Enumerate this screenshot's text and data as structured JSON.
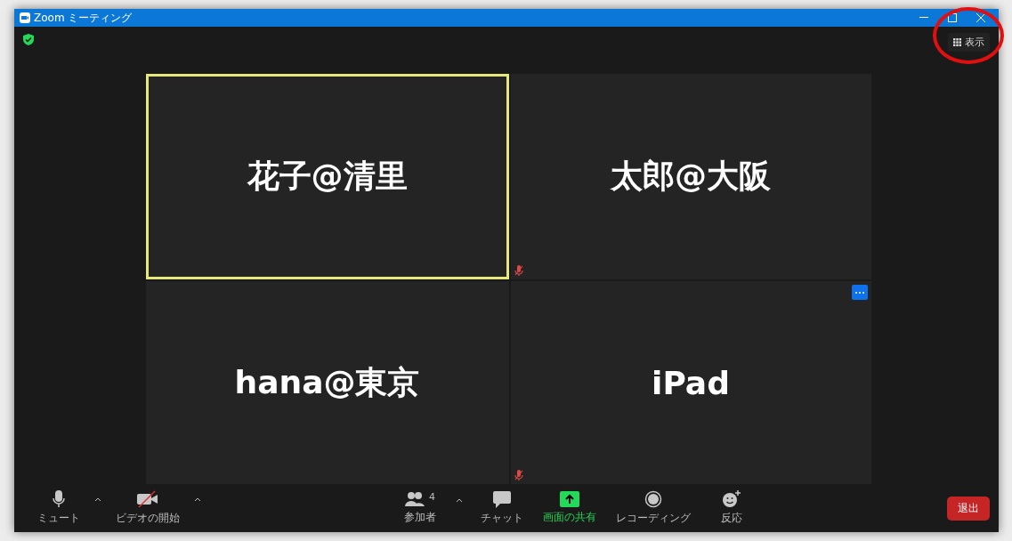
{
  "window": {
    "title": "Zoom ミーティング"
  },
  "top_bar": {
    "encrypted": true,
    "view_button": "表示",
    "view_button_circled": true
  },
  "tiles": [
    {
      "name": "花子@清里",
      "speaking": true,
      "muted": false,
      "menu_button": false
    },
    {
      "name": "太郎@大阪",
      "speaking": false,
      "muted": true,
      "menu_button": false
    },
    {
      "name": "hana@東京",
      "speaking": false,
      "muted": false,
      "menu_button": false
    },
    {
      "name": "iPad",
      "speaking": false,
      "muted": true,
      "menu_button": true
    }
  ],
  "toolbar": {
    "left": [
      {
        "kind": "mic",
        "label": "ミュート",
        "caret": true
      },
      {
        "kind": "video_off",
        "label": "ビデオの開始",
        "caret": true
      }
    ],
    "center": [
      {
        "kind": "participants",
        "label": "参加者",
        "count": "4",
        "caret": true
      },
      {
        "kind": "chat",
        "label": "チャット",
        "caret": false
      },
      {
        "kind": "share",
        "label": "画面の共有",
        "caret": false
      },
      {
        "kind": "record",
        "label": "レコーディング",
        "caret": false
      },
      {
        "kind": "reactions",
        "label": "反応",
        "caret": false
      }
    ],
    "leave_button": "退出"
  }
}
